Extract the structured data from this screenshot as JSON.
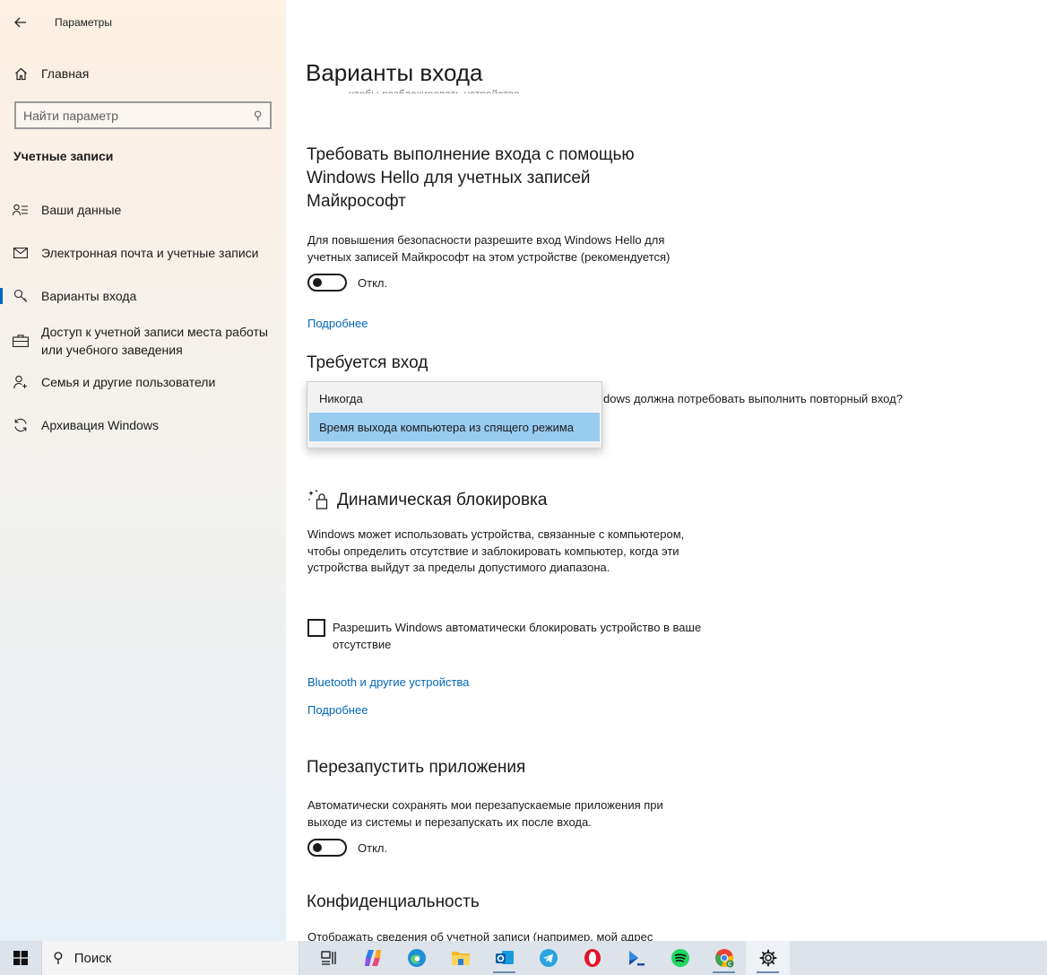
{
  "window": {
    "title": "Параметры"
  },
  "sidebar": {
    "home_label": "Главная",
    "search_placeholder": "Найти параметр",
    "section_heading": "Учетные записи",
    "items": [
      {
        "label": "Ваши данные",
        "icon": "person-list-icon"
      },
      {
        "label": "Электронная почта и учетные записи",
        "icon": "mail-icon"
      },
      {
        "label": "Варианты входа",
        "icon": "key-icon",
        "selected": true
      },
      {
        "label": "Доступ к учетной записи места работы или учебного заведения",
        "icon": "briefcase-icon"
      },
      {
        "label": "Семья и другие пользователи",
        "icon": "person-add-icon"
      },
      {
        "label": "Архивация Windows",
        "icon": "sync-icon"
      }
    ]
  },
  "main": {
    "page_title": "Варианты входа",
    "scrolled_text": "чтобы разблокировать устройство",
    "hello_section": {
      "heading": "Требовать выполнение входа с помощью Windows Hello для учетных записей Майкрософт",
      "description": "Для повышения безопасности разрешите вход Windows Hello для учетных записей Майкрософт на этом устройстве (рекомендуется)",
      "toggle_state": "Откл.",
      "more_link": "Подробнее"
    },
    "require_signin": {
      "heading": "Требуется вход",
      "question_partial": "dows должна потребовать выполнить повторный вход?",
      "dropdown_options": [
        "Никогда",
        "Время выхода компьютера из спящего режима"
      ],
      "highlighted_option": "Время выхода компьютера из спящего режима"
    },
    "dynamic_lock": {
      "heading": "Динамическая блокировка",
      "description": "Windows может использовать устройства, связанные с компьютером, чтобы определить отсутствие и заблокировать компьютер, когда эти устройства выйдут за пределы допустимого диапазона.",
      "checkbox_label": "Разрешить Windows автоматически блокировать устройство в ваше отсутствие",
      "bluetooth_link": "Bluetooth и другие устройства",
      "more_link": "Подробнее"
    },
    "restart_apps": {
      "heading": "Перезапустить приложения",
      "description": "Автоматически сохранять мои перезапускаемые приложения при выходе из системы и перезапускать их после входа.",
      "toggle_state": "Откл."
    },
    "privacy": {
      "heading": "Конфиденциальность",
      "description_partial": "Отображать сведения об учетной записи (например, мой адрес"
    }
  },
  "taskbar": {
    "search_label": "Поиск",
    "apps": [
      "task-view-icon",
      "copilot-icon",
      "edge-icon",
      "file-explorer-icon",
      "outlook-icon",
      "telegram-icon",
      "opera-icon",
      "terminal-icon",
      "spotify-icon",
      "chrome-icon",
      "settings-icon"
    ]
  }
}
